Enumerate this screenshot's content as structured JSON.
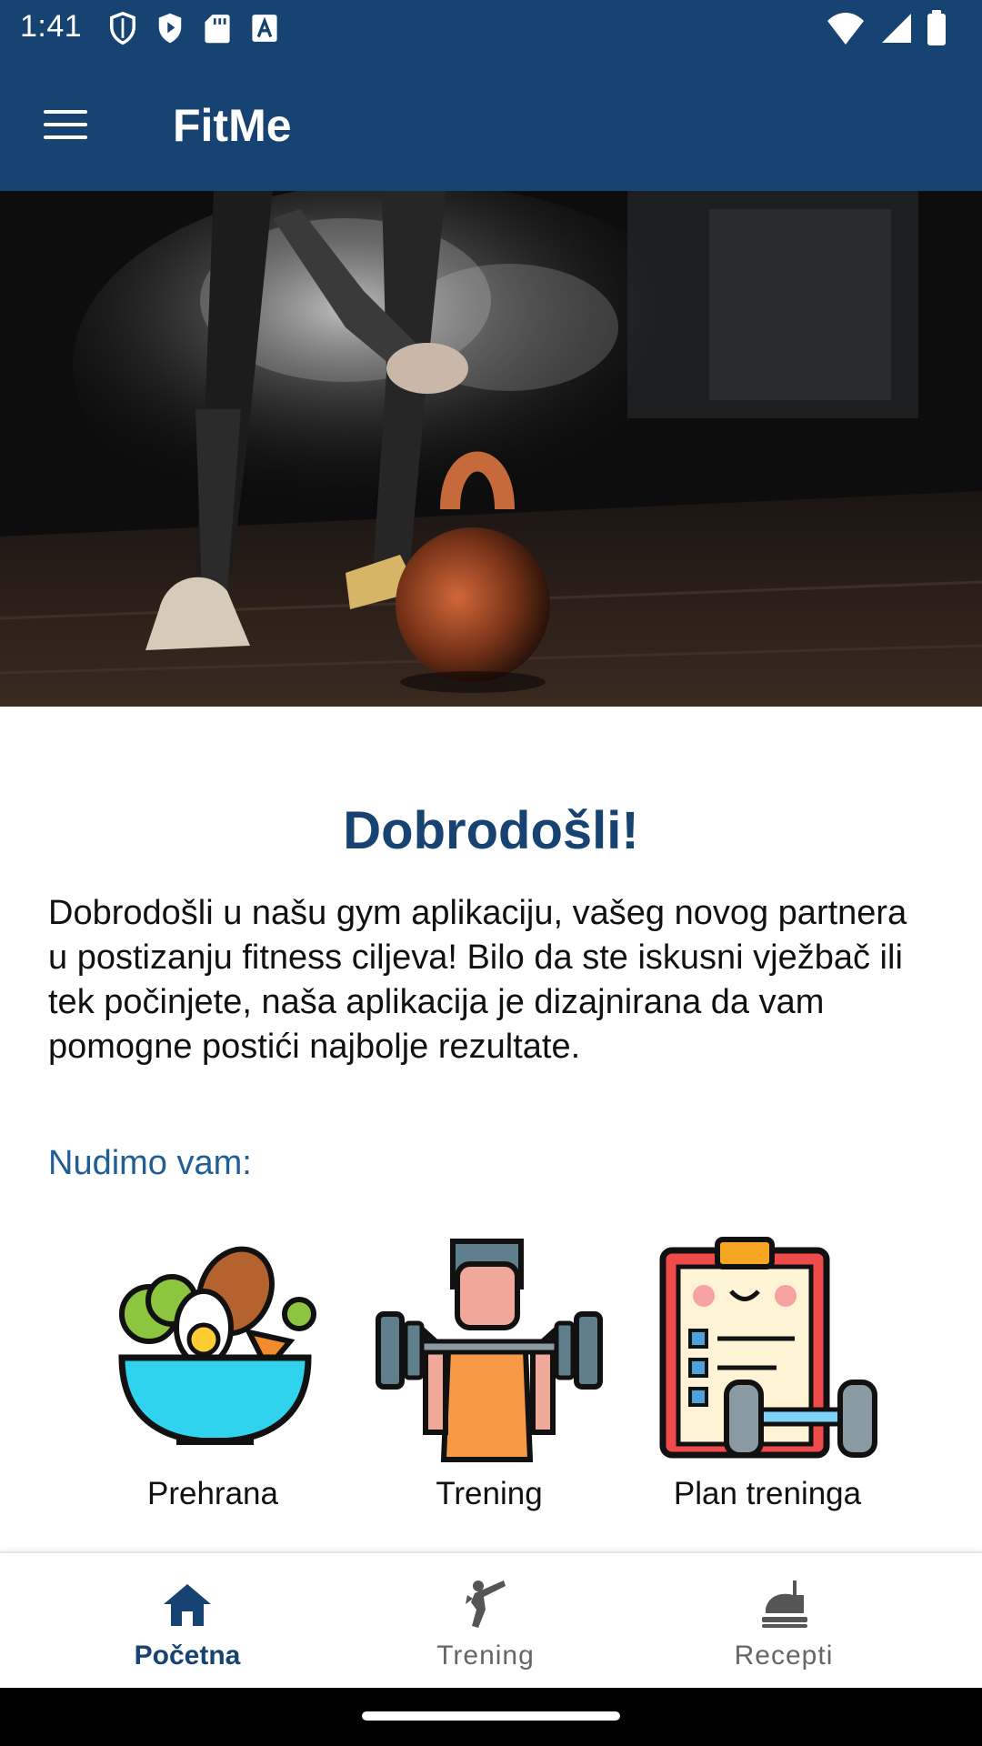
{
  "status_bar": {
    "time": "1:41",
    "left_icons": [
      "shield-icon",
      "play-protect-icon",
      "sd-card-icon",
      "font-icon"
    ],
    "right_icons": [
      "wifi-icon",
      "signal-icon",
      "battery-icon"
    ]
  },
  "app_bar": {
    "title": "FitMe",
    "menu_icon": "hamburger-menu-icon"
  },
  "content": {
    "welcome_title": "Dobrodošli!",
    "intro_text": "Dobrodošli u našu gym aplikaciju, vašeg novog partnera u postizanju fitness ciljeva! Bilo da ste iskusni vježbač ili tek počinjete, naša aplikacija je dizajnirana da vam pomogne postići najbolje rezultate.",
    "offer_label": "Nudimo vam:",
    "features": [
      {
        "label": "Prehrana",
        "icon": "salad-bowl-icon"
      },
      {
        "label": "Trening",
        "icon": "weightlifter-icon"
      },
      {
        "label": "Plan treninga",
        "icon": "clipboard-plan-icon"
      }
    ]
  },
  "bottom_nav": {
    "items": [
      {
        "label": "Početna",
        "icon": "home-icon",
        "active": true
      },
      {
        "label": "Trening",
        "icon": "martial-arts-icon",
        "active": false
      },
      {
        "label": "Recepti",
        "icon": "food-recipe-icon",
        "active": false
      }
    ]
  },
  "colors": {
    "primary": "#174372",
    "accent_text": "#1f5e96",
    "inactive": "#666666"
  }
}
